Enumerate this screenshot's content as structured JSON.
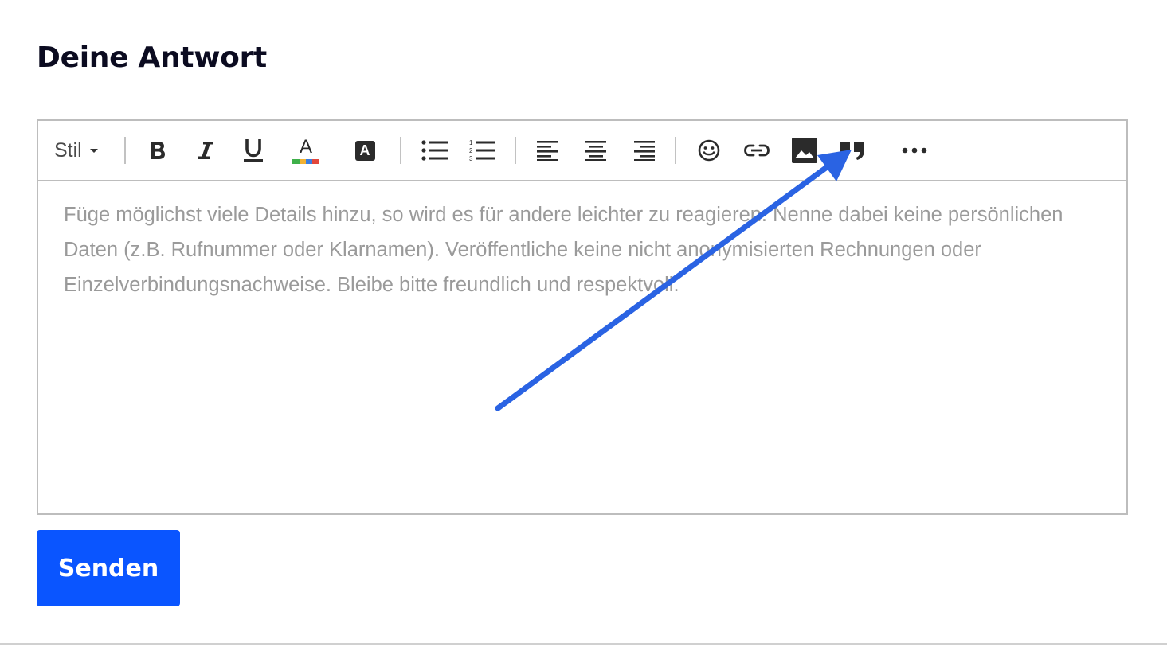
{
  "heading": "Deine Antwort",
  "toolbar": {
    "style_label": "Stil",
    "text_color_letter": "A",
    "highlight_letter": "A"
  },
  "editor": {
    "placeholder": "Füge möglichst viele Details hinzu, so wird es für andere leichter zu reagieren. Nenne dabei keine persönlichen Daten (z.B. Rufnummer oder Klarnamen). Veröffentliche keine nicht anonymisierten Rechnungen oder Einzelverbindungsnachweise. Bleibe bitte freundlich und respektvoll."
  },
  "submit_label": "Senden",
  "colors": {
    "accent": "#0a55ff",
    "annotation_arrow": "#2a63e3",
    "placeholder_text": "#9a9a9a",
    "border": "#bdbdbd"
  },
  "icons": [
    "chevron-down-icon",
    "bold-icon",
    "italic-icon",
    "underline-icon",
    "text-color-icon",
    "highlight-icon",
    "bullet-list-icon",
    "numbered-list-icon",
    "align-left-icon",
    "align-center-icon",
    "align-right-icon",
    "emoji-icon",
    "link-icon",
    "image-icon",
    "quote-icon",
    "more-icon"
  ]
}
